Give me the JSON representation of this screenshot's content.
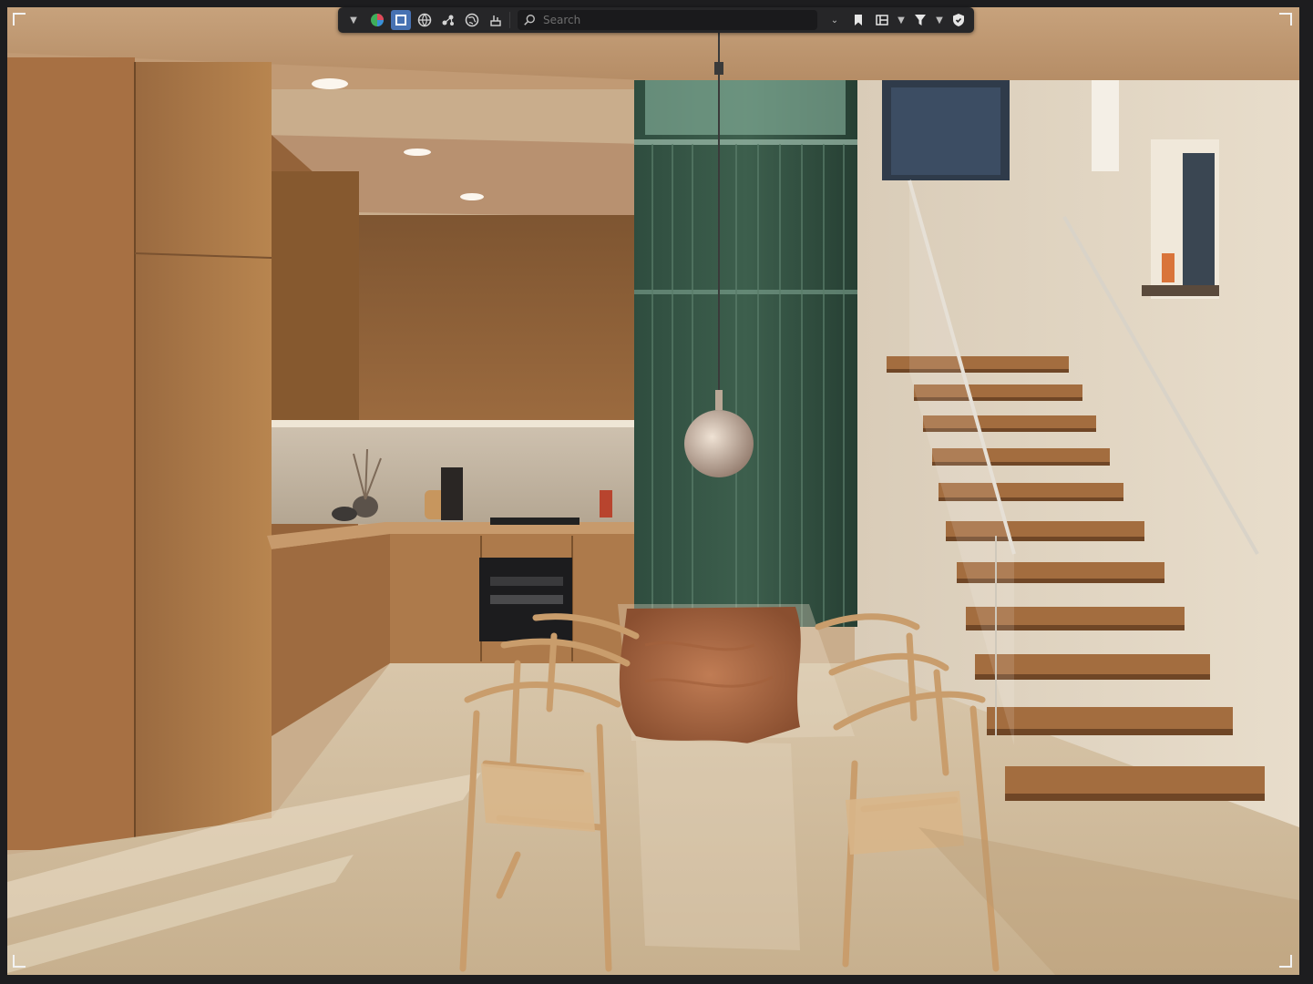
{
  "toolbar": {
    "search_placeholder": "Search",
    "icons": [
      "chevron-down",
      "color-sphere",
      "selectable-square",
      "wire-globe",
      "nodes",
      "globe",
      "armature",
      "search",
      "chevron-down",
      "bookmark",
      "layout",
      "filter",
      "shield"
    ]
  },
  "colors": {
    "accent": "#4772b3",
    "toolbar_bg": "#262628",
    "wood": "#a87449",
    "glass": "#2d4a3c",
    "floor": "#d2c2a8"
  }
}
